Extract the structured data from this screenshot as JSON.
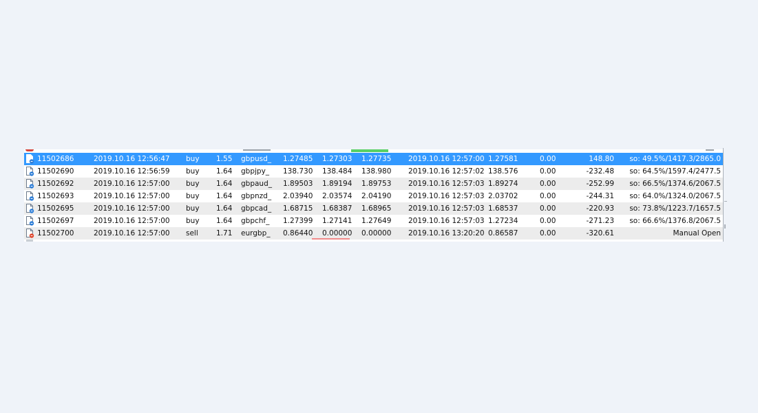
{
  "trades": [
    {
      "ticket": "11502686",
      "time": "2019.10.16 12:56:47",
      "type": "buy",
      "volume": "1.55",
      "symbol": "gbpusd_",
      "price": "1.27485",
      "sl": "1.27303",
      "tp": "1.27735",
      "close_time": "2019.10.16 12:57:00",
      "close_price": "1.27581",
      "swap": "0.00",
      "profit": "148.80",
      "comment": "so: 49.5%/1417.3/2865.0",
      "selected": true,
      "icon": "buy-order-icon"
    },
    {
      "ticket": "11502690",
      "time": "2019.10.16 12:56:59",
      "type": "buy",
      "volume": "1.64",
      "symbol": "gbpjpy_",
      "price": "138.730",
      "sl": "138.484",
      "tp": "138.980",
      "close_time": "2019.10.16 12:57:02",
      "close_price": "138.576",
      "swap": "0.00",
      "profit": "-232.48",
      "comment": "so: 64.5%/1597.4/2477.5",
      "selected": false,
      "icon": "buy-order-icon"
    },
    {
      "ticket": "11502692",
      "time": "2019.10.16 12:57:00",
      "type": "buy",
      "volume": "1.64",
      "symbol": "gbpaud_",
      "price": "1.89503",
      "sl": "1.89194",
      "tp": "1.89753",
      "close_time": "2019.10.16 12:57:03",
      "close_price": "1.89274",
      "swap": "0.00",
      "profit": "-252.99",
      "comment": "so: 66.5%/1374.6/2067.5",
      "selected": false,
      "icon": "buy-order-icon"
    },
    {
      "ticket": "11502693",
      "time": "2019.10.16 12:57:00",
      "type": "buy",
      "volume": "1.64",
      "symbol": "gbpnzd_",
      "price": "2.03940",
      "sl": "2.03574",
      "tp": "2.04190",
      "close_time": "2019.10.16 12:57:03",
      "close_price": "2.03702",
      "swap": "0.00",
      "profit": "-244.31",
      "comment": "so: 64.0%/1324.0/2067.5",
      "selected": false,
      "icon": "buy-order-icon"
    },
    {
      "ticket": "11502695",
      "time": "2019.10.16 12:57:00",
      "type": "buy",
      "volume": "1.64",
      "symbol": "gbpcad_",
      "price": "1.68715",
      "sl": "1.68387",
      "tp": "1.68965",
      "close_time": "2019.10.16 12:57:03",
      "close_price": "1.68537",
      "swap": "0.00",
      "profit": "-220.93",
      "comment": "so: 73.8%/1223.7/1657.5",
      "selected": false,
      "icon": "buy-order-icon"
    },
    {
      "ticket": "11502697",
      "time": "2019.10.16 12:57:00",
      "type": "buy",
      "volume": "1.64",
      "symbol": "gbpchf_",
      "price": "1.27399",
      "sl": "1.27141",
      "tp": "1.27649",
      "close_time": "2019.10.16 12:57:03",
      "close_price": "1.27234",
      "swap": "0.00",
      "profit": "-271.23",
      "comment": "so: 66.6%/1376.8/2067.5",
      "selected": false,
      "icon": "buy-order-icon"
    },
    {
      "ticket": "11502700",
      "time": "2019.10.16 12:57:00",
      "type": "sell",
      "volume": "1.71",
      "symbol": "eurgbp_",
      "price": "0.86440",
      "sl": "0.00000",
      "tp": "0.00000",
      "close_time": "2019.10.16 13:20:20",
      "close_price": "0.86587",
      "swap": "0.00",
      "profit": "-320.61",
      "comment": "Manual Open",
      "selected": false,
      "icon": "sell-order-icon"
    }
  ],
  "colors": {
    "selected_row": "#3399ff",
    "alt_row": "#ececec",
    "buy_icon_accent": "#2f7fd8",
    "sell_icon_accent": "#e0482f",
    "tp_marker": "#57d063",
    "sl_marker": "#f08b8b"
  }
}
